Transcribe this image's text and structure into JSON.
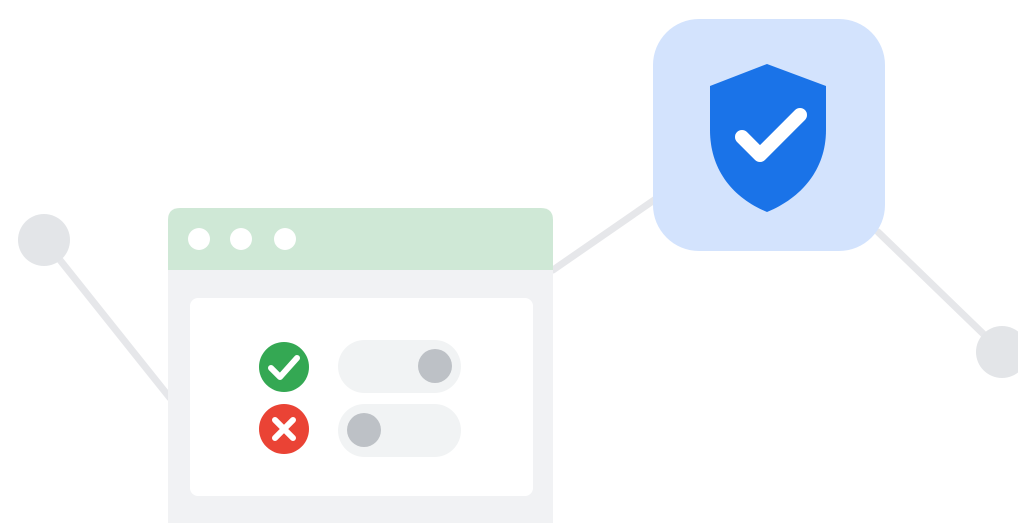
{
  "illustration": {
    "icons": {
      "shield": "shield-check-icon",
      "success": "check-circle-icon",
      "error": "x-circle-icon"
    },
    "toggles": [
      {
        "state": "on"
      },
      {
        "state": "off"
      }
    ],
    "colors": {
      "connector": "#e6e7ea",
      "node": "#e3e5e8",
      "window_titlebar": "#cfe8d6",
      "window_body": "#f1f2f4",
      "window_panel": "#ffffff",
      "titlebar_dots": "#ffffff",
      "shield_tile": "#d3e3fd",
      "shield": "#1a73e8",
      "success": "#34a853",
      "error": "#ea4335",
      "toggle_track": "#f1f3f4",
      "toggle_knob": "#bdc1c6"
    }
  }
}
